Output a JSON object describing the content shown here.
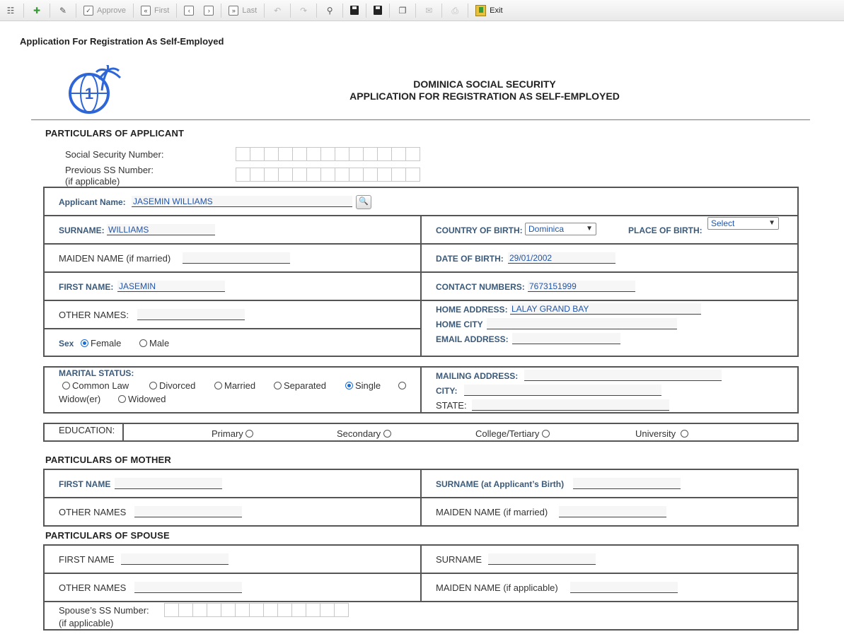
{
  "toolbar": {
    "approve": "Approve",
    "first": "First",
    "last": "Last",
    "exit": "Exit"
  },
  "page_title": "Application For Registration As Self-Employed",
  "doc_header": {
    "line1": "DOMINICA SOCIAL SECURITY",
    "line2": "APPLICATION FOR REGISTRATION AS SELF-EMPLOYED"
  },
  "applicant": {
    "section_title": "PARTICULARS OF APPLICANT",
    "ss_number_label": "Social Security Number:",
    "prev_ss_label": "Previous SS Number:",
    "prev_ss_note": "(if applicable)",
    "applicant_name_label": "Applicant Name:",
    "applicant_name_value": "JASEMIN WILLIAMS",
    "surname_label": "SURNAME:",
    "surname_value": "WILLIAMS",
    "country_label": "COUNTRY OF BIRTH:",
    "country_value": "Dominica",
    "place_label": "PLACE OF BIRTH:",
    "place_value": "Select",
    "maiden_label": "MAIDEN NAME (if married)",
    "dob_label": "DATE OF BIRTH:",
    "dob_value": "29/01/2002",
    "first_name_label": "FIRST NAME:",
    "first_name_value": "JASEMIN",
    "contact_label": "CONTACT NUMBERS:",
    "contact_value": "7673151999",
    "other_names_label": "OTHER NAMES:",
    "home_address_label": "HOME ADDRESS:",
    "home_address_value": "LALAY GRAND BAY",
    "home_city_label": "HOME CITY",
    "email_label": "EMAIL ADDRESS:",
    "sex_label": "Sex",
    "sex_female": "Female",
    "sex_male": "Male"
  },
  "marital": {
    "label": "MARITAL STATUS:",
    "common_law": "Common Law",
    "divorced": "Divorced",
    "married": "Married",
    "separated": "Separated",
    "single": "Single",
    "widower": "Widow(er)",
    "widowed": "Widowed",
    "mailing_label": "MAILING ADDRESS:",
    "city_label": "CITY:",
    "state_label": "STATE:"
  },
  "education": {
    "label": "EDUCATION:",
    "primary": "Primary",
    "secondary": "Secondary",
    "college": "College/Tertiary",
    "university": "University"
  },
  "mother": {
    "section_title": "PARTICULARS OF MOTHER",
    "first_name_label": "FIRST NAME",
    "surname_label": "SURNAME (at Applicant’s Birth)",
    "other_names_label": "OTHER NAMES",
    "maiden_label": "MAIDEN NAME (if married)"
  },
  "spouse": {
    "section_title": "PARTICULARS OF SPOUSE",
    "first_name_label": "FIRST NAME",
    "surname_label": "SURNAME",
    "other_names_label": "OTHER NAMES",
    "maiden_label": "MAIDEN NAME (if applicable)",
    "ss_label": "Spouse’s SS Number:",
    "ss_note": "(if applicable)"
  }
}
